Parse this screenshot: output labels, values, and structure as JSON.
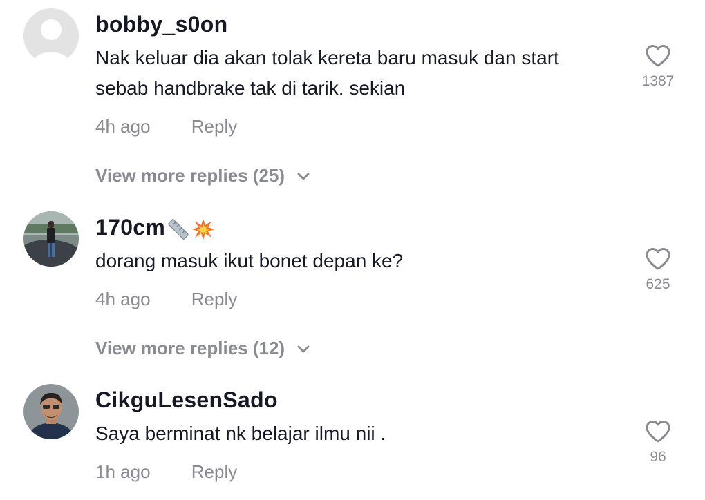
{
  "colors": {
    "text": "#161823",
    "secondary": "#8a8b91",
    "background": "#ffffff"
  },
  "comments": [
    {
      "username": "bobby_s0on",
      "username_emoji": [],
      "avatar": "default-avatar",
      "text_lines": [
        "Nak keluar dia akan tolak kereta baru masuk dan start",
        "sebab handbrake tak di tarik. sekian"
      ],
      "time": "4h ago",
      "reply_label": "Reply",
      "like_count": "1387",
      "view_more_label": "View more replies (25)"
    },
    {
      "username": "170cm",
      "username_emoji": [
        "ruler-icon",
        "collision-icon"
      ],
      "avatar": "photo-avatar-car",
      "text_lines": [
        "dorang masuk ikut bonet depan ke?"
      ],
      "time": "4h ago",
      "reply_label": "Reply",
      "like_count": "625",
      "view_more_label": "View more replies (12)"
    },
    {
      "username": "CikguLesenSado",
      "username_emoji": [],
      "avatar": "photo-avatar-man",
      "text_lines": [
        "Saya berminat nk belajar ilmu nii ."
      ],
      "time": "1h ago",
      "reply_label": "Reply",
      "like_count": "96"
    }
  ]
}
